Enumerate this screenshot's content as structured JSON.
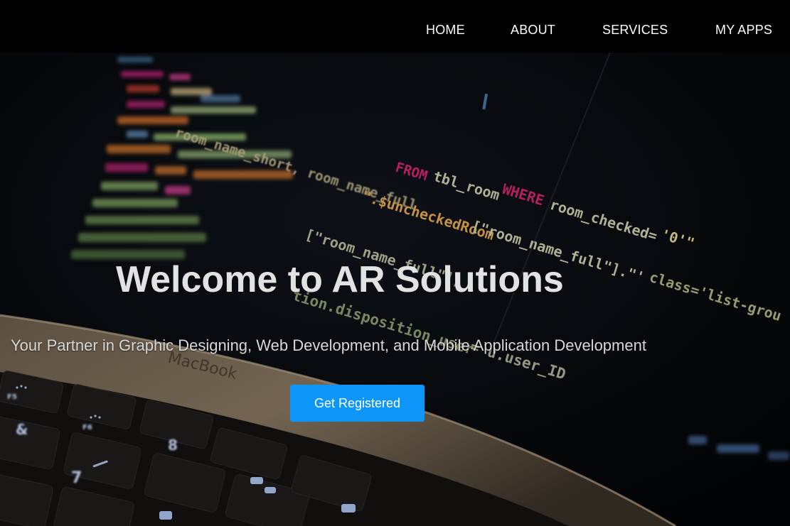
{
  "nav": {
    "items": [
      {
        "label": "HOME"
      },
      {
        "label": "ABOUT"
      },
      {
        "label": "SERVICES"
      },
      {
        "label": "MY APPS"
      }
    ]
  },
  "hero": {
    "title": "Welcome to AR Solutions",
    "subtitle": "Your Partner in Graphic Designing, Web Development, and Mobile Application Development",
    "cta_label": "Get Registered"
  },
  "background": {
    "code_lines": [
      "room_name_short, room_name_full FROM tbl_room WHERE room_checked='0'",
      "\".$uncheckedRoom[\"room_name_full\"];",
      "[\"room_name_full\"].\"' class='list-grou",
      "tion.disposition_user = u.user_ID",
      "MacBook"
    ],
    "keyword_from": "FROM",
    "keyword_where": "WHERE",
    "key_labels": [
      "F5",
      "F6",
      "&",
      "7",
      "8"
    ]
  },
  "colors": {
    "nav_bg": "#000000",
    "cta_bg": "#0d96f8",
    "text_light": "#e2e2e2"
  }
}
